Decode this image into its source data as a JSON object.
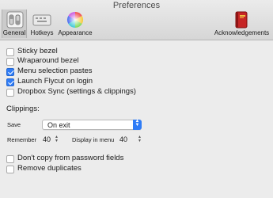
{
  "window": {
    "title": "Preferences"
  },
  "toolbar": {
    "items": [
      {
        "label": "General",
        "icon": "general-switch-icon",
        "selected": true
      },
      {
        "label": "Hotkeys",
        "icon": "keyboard-icon"
      },
      {
        "label": "Appearance",
        "icon": "color-wheel-icon"
      },
      {
        "label": "Acknowledgements",
        "icon": "red-book-icon"
      }
    ]
  },
  "general": {
    "options": [
      {
        "label": "Sticky bezel",
        "checked": false
      },
      {
        "label": "Wraparound bezel",
        "checked": false
      },
      {
        "label": "Menu selection pastes",
        "checked": true
      },
      {
        "label": "Launch Flycut on login",
        "checked": true
      },
      {
        "label": "Dropbox Sync (settings & clippings)",
        "checked": false
      }
    ],
    "clippings": {
      "heading": "Clippings:",
      "save_label": "Save",
      "save_value": "On exit",
      "remember_label": "Remember",
      "remember_value": "40",
      "display_label": "Display in menu",
      "display_value": "40"
    },
    "bottom_options": [
      {
        "label": "Don't copy from password fields",
        "checked": false
      },
      {
        "label": "Remove duplicates",
        "checked": false
      }
    ]
  },
  "colors": {
    "accent": "#2f7cf6",
    "background": "#ececec"
  }
}
